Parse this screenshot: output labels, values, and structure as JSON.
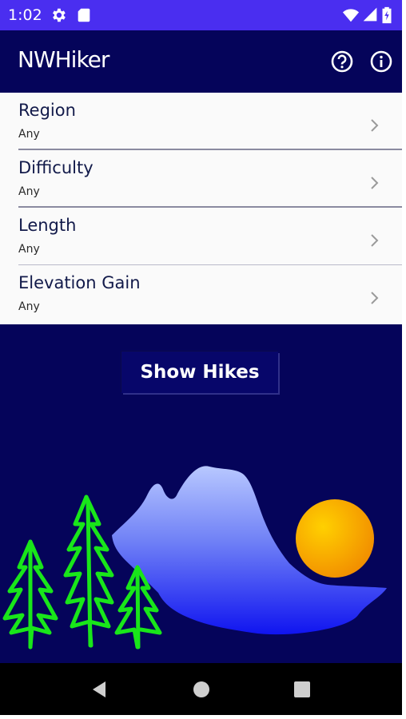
{
  "status_bar": {
    "time": "1:02",
    "icons": [
      "settings-gear-icon",
      "sd-card-icon",
      "wifi-icon",
      "cell-signal-icon",
      "battery-icon"
    ]
  },
  "app_bar": {
    "title": "NWHiker",
    "actions": [
      "help-icon",
      "info-icon"
    ]
  },
  "filters": [
    {
      "label": "Region",
      "value": "Any"
    },
    {
      "label": "Difficulty",
      "value": "Any"
    },
    {
      "label": "Length",
      "value": "Any"
    },
    {
      "label": "Elevation Gain",
      "value": "Any"
    }
  ],
  "show_button": {
    "label": "Show Hikes"
  },
  "nav_bar": {
    "buttons": [
      "back-icon",
      "home-icon",
      "recents-icon"
    ]
  },
  "colors": {
    "status_bar": "#4a2ef0",
    "primary_dark": "#05045a",
    "list_background": "#fafafa",
    "trees": "#19e61a",
    "sun": "#f7b500",
    "mountain": "#6a7cf5"
  }
}
